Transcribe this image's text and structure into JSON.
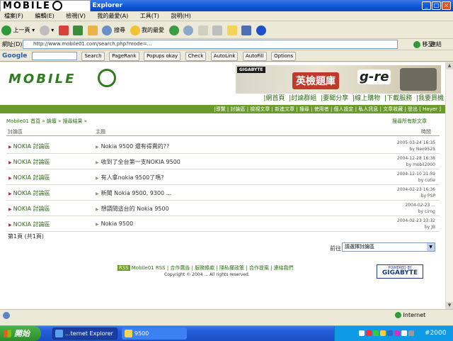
{
  "window": {
    "title": "...ebuil Explorer",
    "logo_overlay": "MOBILE"
  },
  "menubar": [
    "檔案(F)",
    "編輯(E)",
    "檢視(V)",
    "我的最愛(A)",
    "工具(T)",
    "說明(H)"
  ],
  "toolbar": {
    "back": "上一頁",
    "search": "搜尋",
    "favorites": "我的最愛"
  },
  "address": {
    "label": "網址(D)",
    "url": "http://www.mobile01.com/search.php?mode=...",
    "go": "移至",
    "links": "連結"
  },
  "google_bar": {
    "logo": "Google",
    "search": "Search",
    "pagerank": "PageRank",
    "popups": "Popups okay",
    "check": "Check",
    "autolink": "AutoLink",
    "autofill": "AutoFill",
    "options": "Options"
  },
  "site": {
    "logo": "MOBILE",
    "banner": {
      "brand": "GIGABYTE",
      "headline": "英檢題庫",
      "gre": "g-re"
    },
    "topnav": [
      "|網首頁",
      "|討論群組",
      "|要聞分享",
      "|線上購物",
      "|下載服務",
      "|我要買機"
    ],
    "subnav": "|導覽 | 討論區 | 檢視文章 | 新進文章 | 搜尋 | 使用者 | 個人設定 | 私人訊息 | 文章收藏 | 登出 [ Hayer ]",
    "breadcrumb": "Mobile01 首頁 » 論壇 » 搜尋結果 »",
    "new_topics": "搜尋所有新文章",
    "columns": {
      "forum": "討論區",
      "topic": "主題",
      "date": "時間"
    },
    "results": [
      {
        "forum": "NOKIA 討論區",
        "topic": "Nokia 9500 還有得賣的??",
        "date": "2005-03-24 16:35",
        "by": "by Neo9525"
      },
      {
        "forum": "NOKIA 討論區",
        "topic": "收到了全台第一支NOKIA 9500",
        "date": "2004-12-28 16:38",
        "by": "by mobil2000"
      },
      {
        "forum": "NOKIA 討論區",
        "topic": "有人拿nokia 9500了嗎?",
        "date": "2004-12-10 21:59",
        "by": "by cutie"
      },
      {
        "forum": "NOKIA 討論區",
        "topic": "新聞 Nokia 9500, 9300 ...",
        "date": "2004-02-23 16:36",
        "by": "by PSP"
      },
      {
        "forum": "NOKIA 討論區",
        "topic": "想請問這台的 Nokia 9500",
        "date": "2004-02-23 ...",
        "by": "by cirng"
      },
      {
        "forum": "NOKIA 討論區",
        "topic": "Nokia 9500",
        "date": "2004-02-23 23:32",
        "by": "by JB"
      }
    ],
    "page_info": "第1頁 (共1頁)",
    "jump_label": "前往:",
    "jump_value": "請選擇討論區",
    "footer_badge": "RSS",
    "footer_line1": "Mobile01 RSS | 合作廣告 | 服務條款 | 隱私權政策 | 合作提案 | 連絡我們",
    "footer_line2": "Copyright © 2004 ... All rights reserved.",
    "sponsor": {
      "top": "POWERED BY",
      "name": "GIGABYTE"
    }
  },
  "statusbar": {
    "zone": "Internet"
  },
  "taskbar": {
    "start": "開始",
    "tasks": [
      "...ternet Explorer",
      "9500"
    ],
    "clock": "#2000"
  }
}
